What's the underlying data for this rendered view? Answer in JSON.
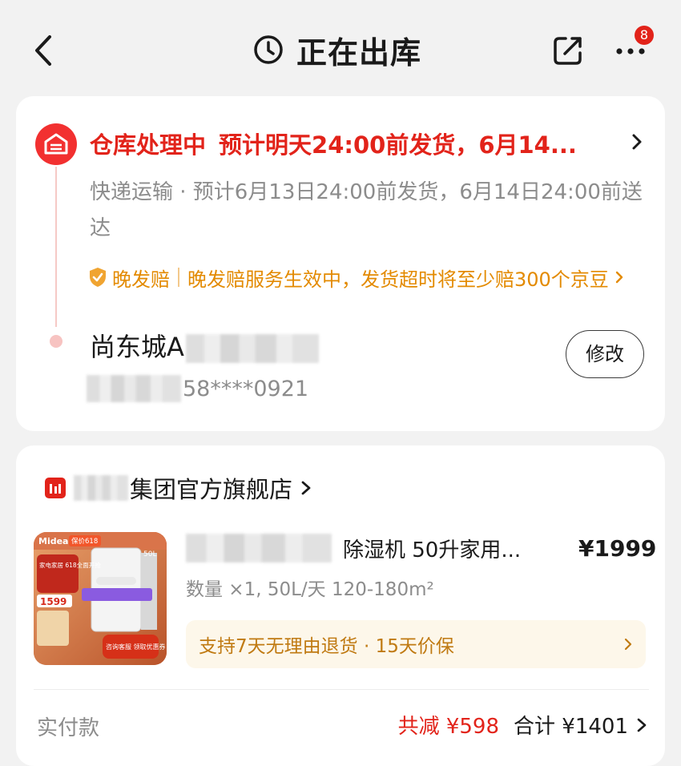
{
  "header": {
    "title": "正在出库",
    "badge_count": "8"
  },
  "status_card": {
    "status_main": "仓库处理中",
    "status_eta": "预计明天24:00前发货，6月14...",
    "delivery_info": "快递运输 · 预计6月13日24:00前发货，6月14日24:00前送达",
    "late_tag": "晚发赔",
    "late_desc": "晚发赔服务生效中，发货超时将至少赔300个京豆",
    "recipient_name_visible": "尚东城A",
    "phone_visible": "58****0921",
    "edit_label": "修改",
    "accent_color": "#e2231a"
  },
  "product_card": {
    "shop_name_visible": "集团官方旗舰店",
    "product_title_visible": "除湿机 50升家用...",
    "price": "¥1999",
    "spec": "数量 ×1, 50L/天 120-180m²",
    "service": "支持7天无理由退货 · 15天价保",
    "paid_label": "实付款",
    "discount": "共减 ¥598",
    "total": "合计 ¥1401",
    "thumbnail": {
      "brand": "Midea",
      "tag": "保价618",
      "capacity": "50L",
      "banner": "家电家居 618全面开抢",
      "price_tag": "1599",
      "button": "咨询客服 领取优惠券"
    }
  }
}
